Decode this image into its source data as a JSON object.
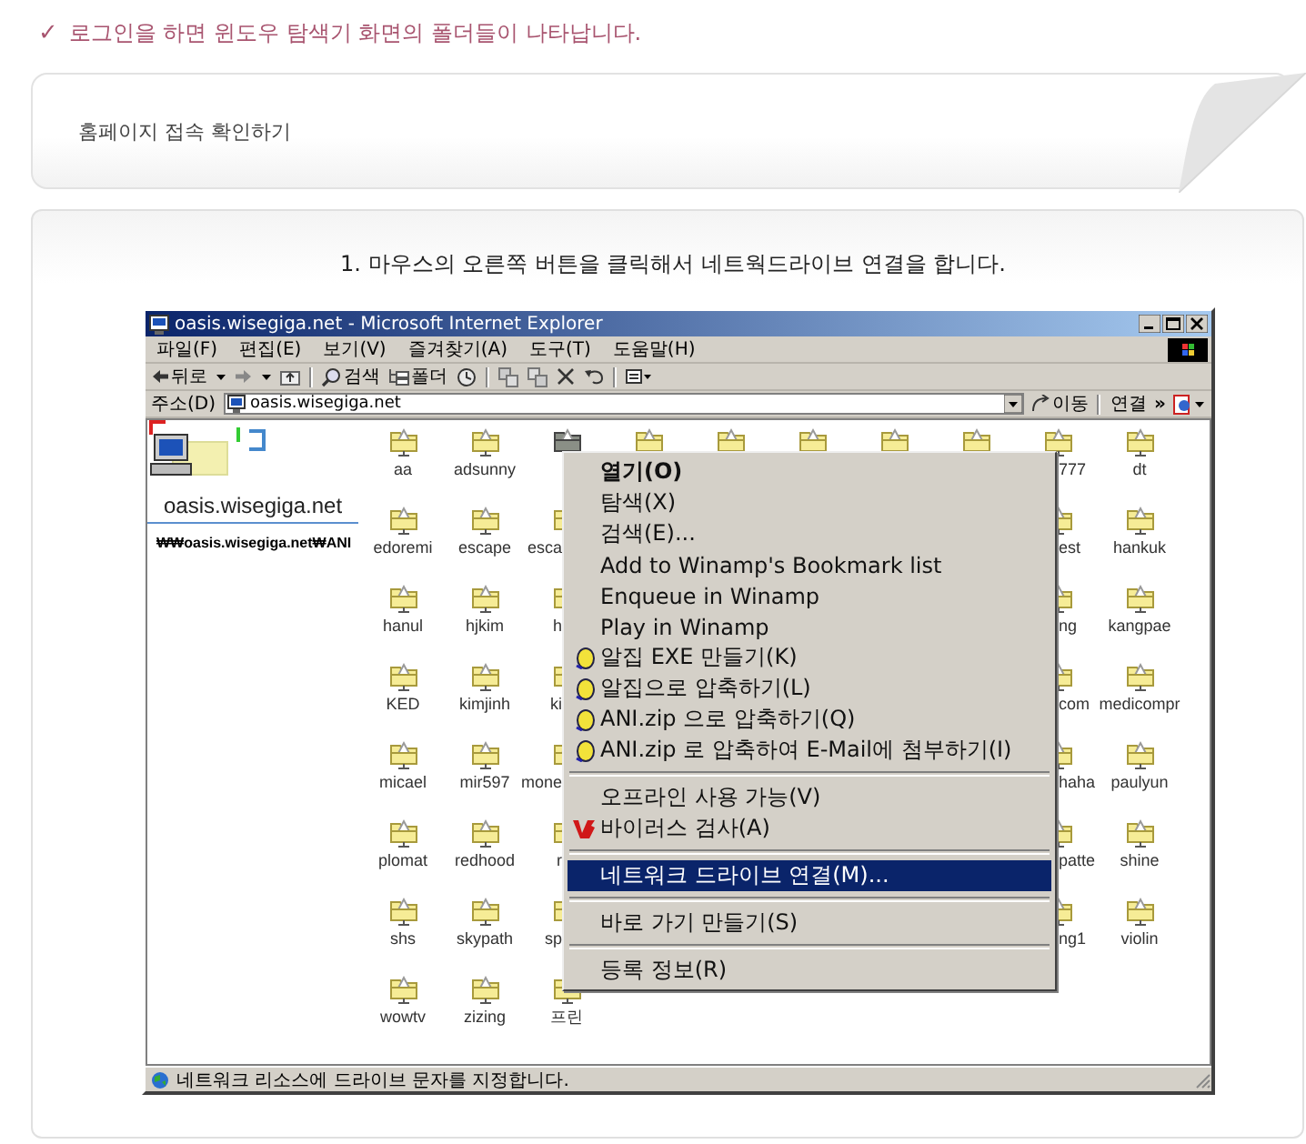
{
  "note": {
    "mark": "✓",
    "text": "로그인을 하면 윈도우 탐색기 화면의 폴더들이 나타납니다."
  },
  "section": {
    "title": "홈페이지 접속 확인하기"
  },
  "step": {
    "title": "1. 마우스의 오른쪽 버튼을 클릭해서 네트웍드라이브 연결을 합니다."
  },
  "window": {
    "title": "oasis.wisegiga.net - Microsoft Internet Explorer",
    "menu": [
      "파일(F)",
      "편집(E)",
      "보기(V)",
      "즐겨찾기(A)",
      "도구(T)",
      "도움말(H)"
    ],
    "toolbar": [
      {
        "kind": "back",
        "label": "뒤로"
      },
      {
        "kind": "forward"
      },
      {
        "kind": "up"
      },
      {
        "kind": "search",
        "label": "검색"
      },
      {
        "kind": "folders",
        "label": "폴더"
      },
      {
        "kind": "history"
      },
      {
        "kind": "move"
      },
      {
        "kind": "copy"
      },
      {
        "kind": "delete"
      },
      {
        "kind": "undo"
      },
      {
        "kind": "views"
      }
    ],
    "address": {
      "label": "주소(D)",
      "value": "oasis.wisegiga.net",
      "go": "이동",
      "links": "연결",
      "more": "»"
    },
    "panel": {
      "title": "oasis.wisegiga.net",
      "path": "₩₩oasis.wisegiga.net₩ANI"
    },
    "folders": [
      [
        {
          "kind": "folder",
          "label": "aa"
        },
        {
          "kind": "folder",
          "label": "adsunny"
        },
        {
          "kind": "selected"
        },
        {
          "kind": "folder"
        },
        {
          "kind": "folder"
        },
        {
          "kind": "folder"
        },
        {
          "kind": "folder"
        },
        {
          "kind": "folder"
        },
        {
          "kind": "folder",
          "label": "777"
        },
        {
          "kind": "folder",
          "label": "dt"
        }
      ],
      [
        {
          "kind": "folder",
          "label": "edoremi"
        },
        {
          "kind": "folder",
          "label": "escape"
        },
        {
          "kind": "folder",
          "label": "esca"
        },
        {
          "kind": "empty"
        },
        {
          "kind": "empty"
        },
        {
          "kind": "empty"
        },
        {
          "kind": "empty"
        },
        {
          "kind": "empty"
        },
        {
          "kind": "folder",
          "label": "est"
        },
        {
          "kind": "folder",
          "label": "hankuk"
        }
      ],
      [
        {
          "kind": "folder",
          "label": "hanul"
        },
        {
          "kind": "folder",
          "label": "hjkim"
        },
        {
          "kind": "folder",
          "label": "h"
        },
        {
          "kind": "empty"
        },
        {
          "kind": "empty"
        },
        {
          "kind": "empty"
        },
        {
          "kind": "empty"
        },
        {
          "kind": "empty"
        },
        {
          "kind": "folder",
          "label": "ng"
        },
        {
          "kind": "folder",
          "label": "kangpae"
        }
      ],
      [
        {
          "kind": "folder",
          "label": "KED"
        },
        {
          "kind": "folder",
          "label": "kimjinh"
        },
        {
          "kind": "folder",
          "label": "ki"
        },
        {
          "kind": "empty"
        },
        {
          "kind": "empty"
        },
        {
          "kind": "empty"
        },
        {
          "kind": "empty"
        },
        {
          "kind": "empty"
        },
        {
          "kind": "folder",
          "label": "com"
        },
        {
          "kind": "folder",
          "label": "medicompr"
        }
      ],
      [
        {
          "kind": "folder",
          "label": "micael"
        },
        {
          "kind": "folder",
          "label": "mir597"
        },
        {
          "kind": "folder",
          "label": "mone"
        },
        {
          "kind": "empty"
        },
        {
          "kind": "empty"
        },
        {
          "kind": "empty"
        },
        {
          "kind": "empty"
        },
        {
          "kind": "empty"
        },
        {
          "kind": "folder",
          "label": "haha"
        },
        {
          "kind": "folder",
          "label": "paulyun"
        }
      ],
      [
        {
          "kind": "folder",
          "label": "plomat"
        },
        {
          "kind": "folder",
          "label": "redhood"
        },
        {
          "kind": "folder",
          "label": "r"
        },
        {
          "kind": "empty"
        },
        {
          "kind": "empty"
        },
        {
          "kind": "empty"
        },
        {
          "kind": "empty"
        },
        {
          "kind": "empty"
        },
        {
          "kind": "folder",
          "label": "patte"
        },
        {
          "kind": "folder",
          "label": "shine"
        }
      ],
      [
        {
          "kind": "folder",
          "label": "shs"
        },
        {
          "kind": "folder",
          "label": "skypath"
        },
        {
          "kind": "folder",
          "label": "sp"
        },
        {
          "kind": "empty"
        },
        {
          "kind": "empty"
        },
        {
          "kind": "empty"
        },
        {
          "kind": "empty"
        },
        {
          "kind": "empty"
        },
        {
          "kind": "folder",
          "label": "ng1"
        },
        {
          "kind": "folder",
          "label": "violin"
        }
      ],
      [
        {
          "kind": "folder",
          "label": "wowtv"
        },
        {
          "kind": "folder",
          "label": "zizing"
        },
        {
          "kind": "folder",
          "label": "프린"
        }
      ]
    ],
    "context_menu": [
      {
        "kind": "command",
        "label": "열기(O)",
        "default": true,
        "selected": false
      },
      {
        "kind": "command",
        "label": "탐색(X)",
        "default": false,
        "selected": false
      },
      {
        "kind": "command",
        "label": "검색(E)...",
        "default": false,
        "selected": false
      },
      {
        "kind": "command",
        "label": "Add to Winamp's Bookmark list",
        "default": false,
        "selected": false
      },
      {
        "kind": "command",
        "label": "Enqueue in Winamp",
        "default": false,
        "selected": false
      },
      {
        "kind": "command",
        "label": "Play in Winamp",
        "default": false,
        "selected": false
      },
      {
        "kind": "alzip",
        "label": "알집 EXE 만들기(K)",
        "default": false,
        "selected": false
      },
      {
        "kind": "alzip",
        "label": "알집으로 압축하기(L)",
        "default": false,
        "selected": false
      },
      {
        "kind": "alzip",
        "label": "ANI.zip 으로 압축하기(Q)",
        "default": false,
        "selected": false
      },
      {
        "kind": "alzip",
        "label": "ANI.zip 로 압축하여 E-Mail에 첨부하기(I)",
        "default": false,
        "selected": false
      },
      {
        "kind": "separator"
      },
      {
        "kind": "command",
        "label": "오프라인 사용 가능(V)",
        "default": false,
        "selected": false
      },
      {
        "kind": "v3",
        "label": "바이러스 검사(A)",
        "default": false,
        "selected": false
      },
      {
        "kind": "separator"
      },
      {
        "kind": "command",
        "label": "네트워크 드라이브 연결(M)...",
        "default": false,
        "selected": true
      },
      {
        "kind": "separator"
      },
      {
        "kind": "command",
        "label": "바로 가기 만들기(S)",
        "default": false,
        "selected": false
      },
      {
        "kind": "separator"
      },
      {
        "kind": "command",
        "label": "등록 정보(R)",
        "default": false,
        "selected": false
      }
    ],
    "status_bar": {
      "text": "네트워크 리소스에 드라이브 문자를 지정합니다."
    }
  }
}
